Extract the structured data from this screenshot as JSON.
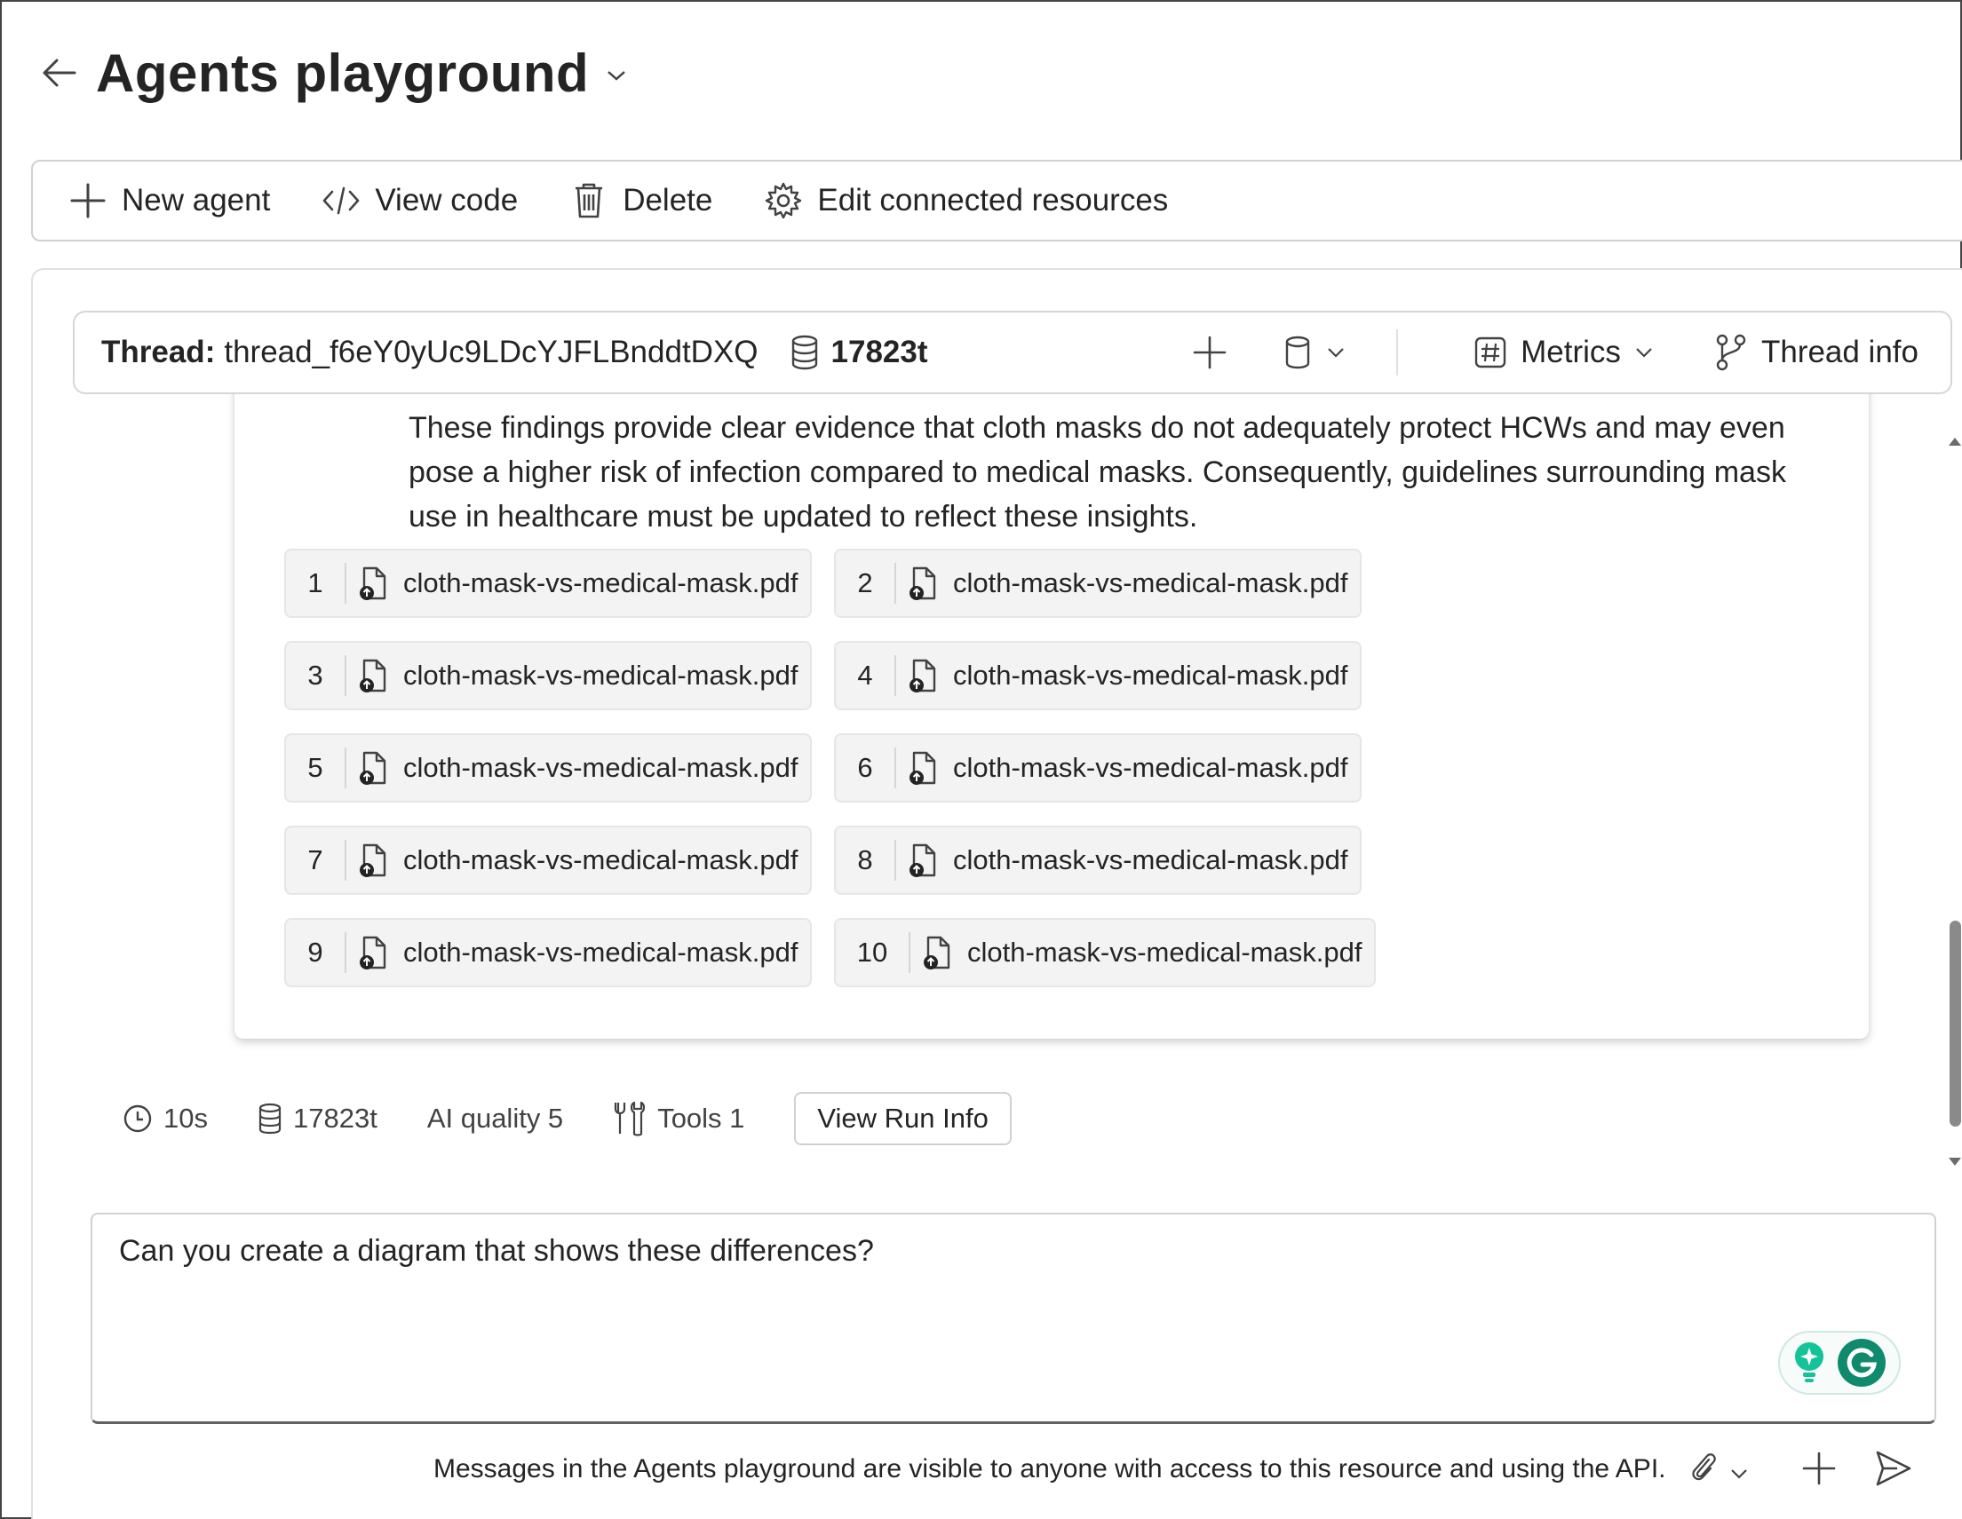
{
  "header": {
    "title": "Agents playground"
  },
  "toolbar": {
    "new_agent": "New agent",
    "view_code": "View code",
    "delete": "Delete",
    "edit_resources": "Edit connected resources"
  },
  "thread": {
    "label": "Thread:",
    "id": "thread_f6eY0yUc9LDcYJFLBnddtDXQ",
    "tokens": "17823t",
    "metrics_label": "Metrics",
    "thread_info_label": "Thread info"
  },
  "message": {
    "text": "These findings provide clear evidence that cloth masks do not adequately protect HCWs and may even pose a higher risk of infection compared to medical masks. Consequently, guidelines surrounding mask use in healthcare must be updated to reflect these insights.",
    "citations": [
      {
        "num": "1",
        "file": "cloth-mask-vs-medical-mask.pdf"
      },
      {
        "num": "2",
        "file": "cloth-mask-vs-medical-mask.pdf"
      },
      {
        "num": "3",
        "file": "cloth-mask-vs-medical-mask.pdf"
      },
      {
        "num": "4",
        "file": "cloth-mask-vs-medical-mask.pdf"
      },
      {
        "num": "5",
        "file": "cloth-mask-vs-medical-mask.pdf"
      },
      {
        "num": "6",
        "file": "cloth-mask-vs-medical-mask.pdf"
      },
      {
        "num": "7",
        "file": "cloth-mask-vs-medical-mask.pdf"
      },
      {
        "num": "8",
        "file": "cloth-mask-vs-medical-mask.pdf"
      },
      {
        "num": "9",
        "file": "cloth-mask-vs-medical-mask.pdf"
      },
      {
        "num": "10",
        "file": "cloth-mask-vs-medical-mask.pdf"
      }
    ]
  },
  "run_info": {
    "duration": "10s",
    "tokens": "17823t",
    "ai_quality": "AI quality 5",
    "tools": "Tools 1",
    "view_run_info": "View Run Info"
  },
  "composer": {
    "value": "Can you create a diagram that shows these differences?",
    "footer_note": "Messages in the Agents playground are visible to anyone with access to this resource and using the API."
  },
  "colors": {
    "grammarly_green": "#15c39a",
    "grammarly_dark": "#0f8a6c",
    "border": "#d1d1d1"
  },
  "icons": [
    "arrow-left-icon",
    "chevron-down-icon",
    "plus-icon",
    "code-icon",
    "trash-icon",
    "gear-icon",
    "database-icon",
    "hash-icon",
    "branch-icon",
    "file-icon",
    "clock-icon",
    "tools-icon",
    "paperclip-icon",
    "send-icon",
    "grammarly-icon",
    "lightbulb-icon"
  ]
}
